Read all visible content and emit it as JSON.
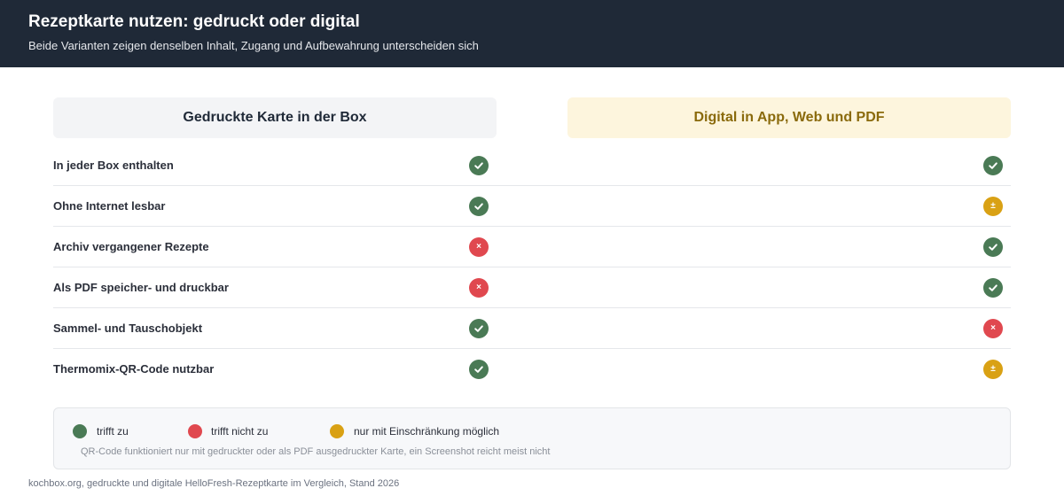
{
  "header": {
    "title": "Rezeptkarte nutzen: gedruckt oder digital",
    "subtitle": "Beide Varianten zeigen denselben Inhalt, Zugang und Aufbewahrung unterscheiden sich"
  },
  "columns": {
    "print": "Gedruckte Karte in der Box",
    "digital": "Digital in App, Web und PDF"
  },
  "rows": [
    {
      "label": "In jeder Box enthalten",
      "print": "yes",
      "digital": "yes"
    },
    {
      "label": "Ohne Internet lesbar",
      "print": "yes",
      "digital": "partial"
    },
    {
      "label": "Archiv vergangener Rezepte",
      "print": "no",
      "digital": "yes"
    },
    {
      "label": "Als PDF speicher- und druckbar",
      "print": "no",
      "digital": "yes"
    },
    {
      "label": "Sammel- und Tauschobjekt",
      "print": "yes",
      "digital": "no"
    },
    {
      "label": "Thermomix-QR-Code nutzbar",
      "print": "yes",
      "digital": "partial"
    }
  ],
  "legend": {
    "yes": "trifft zu",
    "no": "trifft nicht zu",
    "partial": "nur mit Einschränkung möglich",
    "note": "QR-Code funktioniert nur mit gedruckter oder als PDF ausgedruckter Karte, ein Screenshot reicht meist nicht"
  },
  "footer": "kochbox.org, gedruckte und digitale HelloFresh-Rezeptkarte im Vergleich, Stand 2026",
  "colors": {
    "yes": "#4a7a55",
    "no": "#e0484f",
    "partial": "#d9a114",
    "header_bg": "#1f2937",
    "digital_accent": "#8a6a0c"
  },
  "icons": {
    "yes": "check-icon",
    "no": "cross-icon",
    "partial": "plus-minus-icon"
  }
}
